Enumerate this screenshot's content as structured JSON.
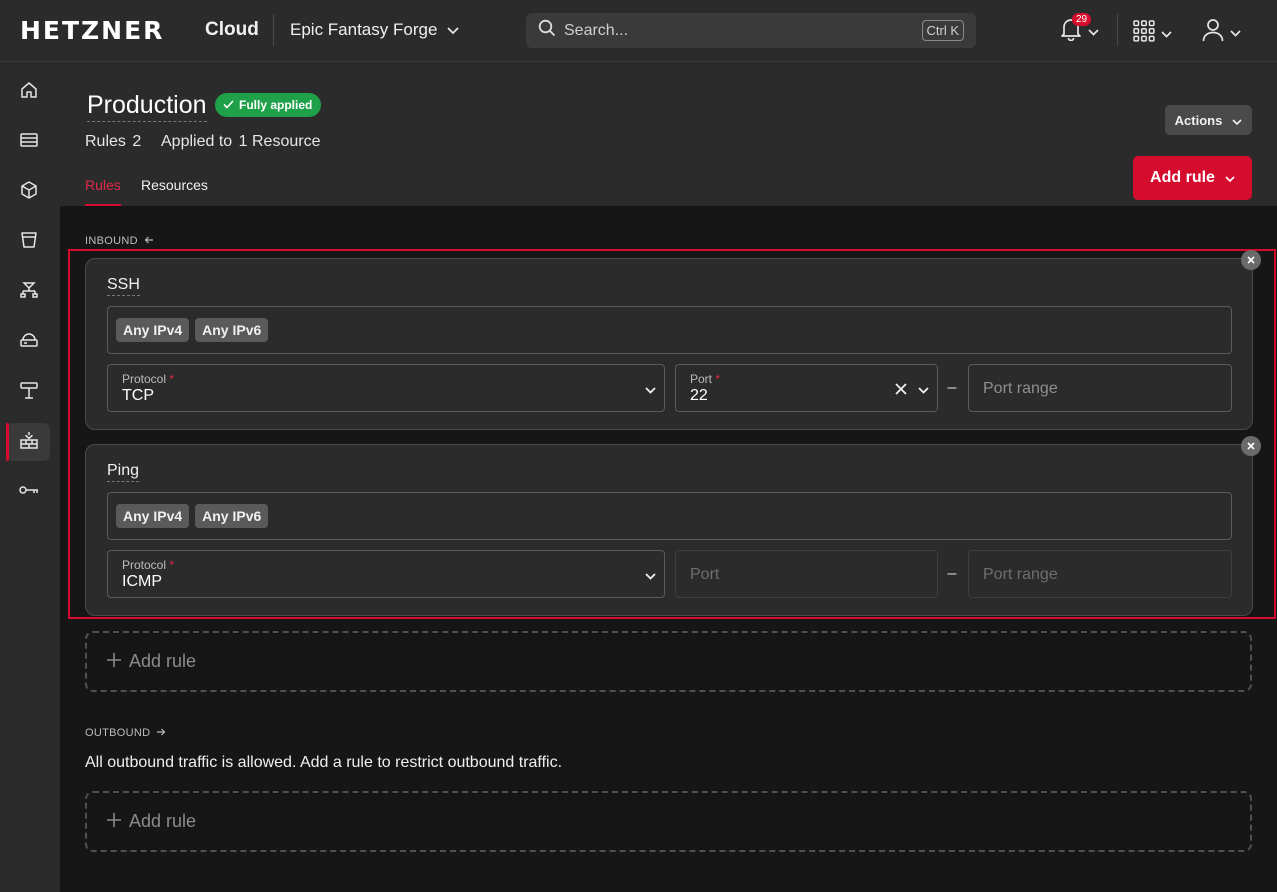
{
  "brand": {
    "logo": "HETZNER",
    "product": "Cloud"
  },
  "project": {
    "name": "Epic Fantasy Forge"
  },
  "search": {
    "placeholder": "Search...",
    "shortcut": "Ctrl K"
  },
  "notifications": {
    "count": "29"
  },
  "sidebar": {
    "items": [
      {
        "icon": "home-icon"
      },
      {
        "icon": "servers-icon"
      },
      {
        "icon": "volumes-icon"
      },
      {
        "icon": "storage-bucket-icon"
      },
      {
        "icon": "load-balancer-icon"
      },
      {
        "icon": "floating-ip-icon"
      },
      {
        "icon": "networks-icon"
      },
      {
        "icon": "firewall-icon",
        "active": true
      },
      {
        "icon": "key-icon"
      }
    ]
  },
  "header": {
    "title": "Production",
    "status": "Fully applied",
    "rules_label": "Rules",
    "rules_count": "2",
    "applied_label": "Applied to",
    "applied_count": "1",
    "applied_unit": "Resource",
    "tabs": [
      {
        "label": "Rules",
        "active": true
      },
      {
        "label": "Resources",
        "active": false
      }
    ],
    "actions_label": "Actions",
    "add_rule_label": "Add rule"
  },
  "inbound": {
    "label": "INBOUND",
    "rules": [
      {
        "name": "SSH",
        "sources": [
          "Any IPv4",
          "Any IPv6"
        ],
        "protocol_label": "Protocol",
        "protocol": "TCP",
        "port_label": "Port",
        "port": "22",
        "port_range_placeholder": "Port range"
      },
      {
        "name": "Ping",
        "sources": [
          "Any IPv4",
          "Any IPv6"
        ],
        "protocol_label": "Protocol",
        "protocol": "ICMP",
        "port_placeholder": "Port",
        "port_range_placeholder": "Port range"
      }
    ],
    "add_rule_label": "Add rule"
  },
  "outbound": {
    "label": "OUTBOUND",
    "message": "All outbound traffic is allowed. Add a rule to restrict outbound traffic.",
    "add_rule_label": "Add rule"
  },
  "colors": {
    "accent": "#d50c2d",
    "success": "#1fa14a",
    "surface": "#2b2b2b",
    "background": "#161616"
  }
}
